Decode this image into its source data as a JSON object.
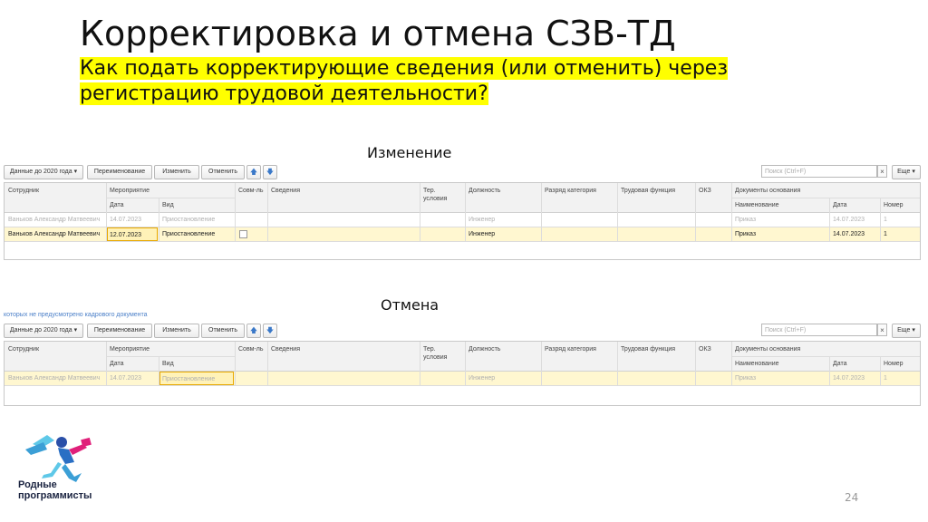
{
  "slide": {
    "title": "Корректировка и отмена СЗВ-ТД",
    "subtitle_line1": "Как подать корректирующие сведения (или отменить) через",
    "subtitle_line2": "регистрацию трудовой деятельности?",
    "page_number": "24",
    "logo_line1": "Родные",
    "logo_line2": "программисты",
    "cancel_note": "которых не предусмотрено кадрового документа"
  },
  "colors": {
    "highlight": "#ffff00",
    "selected_row": "#fff7d0",
    "active_cell_border": "#e8a800",
    "arrow_blue": "#3a78c8"
  },
  "toolbar": {
    "data_before_2020": "Данные до 2020 года",
    "rename": "Переименование",
    "change": "Изменить",
    "cancel": "Отменить",
    "up_icon": "🡅",
    "down_icon": "🡇",
    "search_placeholder": "Поиск (Ctrl+F)",
    "clear": "×",
    "more": "Еще"
  },
  "columns": {
    "employee": "Сотрудник",
    "event": "Мероприятие",
    "date": "Дата",
    "kind": "Вид",
    "part_time": "Совм-ль",
    "info": "Сведения",
    "ter1": "Тер.",
    "ter2": "условия",
    "position": "Должность",
    "category": "Разряд категория",
    "labor_function": "Трудовая функция",
    "okz": "ОКЗ",
    "docs": "Документы основания",
    "doc_name": "Наименование",
    "doc_date": "Дата",
    "doc_number": "Номер"
  },
  "change_section": {
    "title": "Изменение",
    "rows": [
      {
        "employee": "Ваньков Александр Матвеевич",
        "date": "14.07.2023",
        "kind": "Приостановление",
        "position": "Инженер",
        "doc_name": "Приказ",
        "doc_date": "14.07.2023",
        "doc_number": "1"
      },
      {
        "employee": "Ваньков Александр Матвеевич",
        "date": "12.07.2023",
        "kind": "Приостановление",
        "position": "Инженер",
        "doc_name": "Приказ",
        "doc_date": "14.07.2023",
        "doc_number": "1"
      }
    ]
  },
  "cancel_section": {
    "title": "Отмена",
    "rows": [
      {
        "employee": "Ваньков Александр Матвеевич",
        "date": "14.07.2023",
        "kind": "Приостановление",
        "position": "Инженер",
        "doc_name": "Приказ",
        "doc_date": "14.07.2023",
        "doc_number": "1"
      }
    ]
  }
}
